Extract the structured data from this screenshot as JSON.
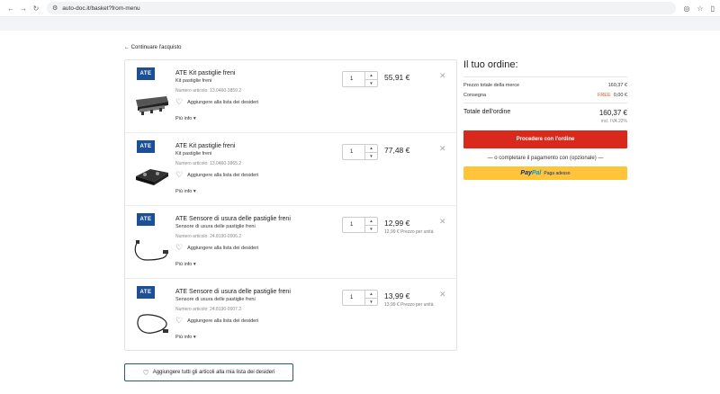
{
  "browser": {
    "url": "auto-doc.it/basket?from-menu"
  },
  "back_link": "← Continuare l'acquisto",
  "items": [
    {
      "brand": "ATE",
      "title": "ATE Kit pastiglie freni",
      "subtitle": "Kit pastiglie freni",
      "article": "Numero articolo: 13.0460-3859.2",
      "wishlist": "Aggiungere alla lista dei desideri",
      "more": "Più info ▾",
      "qty": "1",
      "price": "55,91 €",
      "unit_price": ""
    },
    {
      "brand": "ATE",
      "title": "ATE Kit pastiglie freni",
      "subtitle": "Kit pastiglie freni",
      "article": "Numero articolo: 13.0460-3865.2",
      "wishlist": "Aggiungere alla lista dei desideri",
      "more": "Più info ▾",
      "qty": "1",
      "price": "77,48 €",
      "unit_price": ""
    },
    {
      "brand": "ATE",
      "title": "ATE Sensore di usura delle pastiglie freni",
      "subtitle": "Sensore di usura delle pastiglie freni",
      "article": "Numero articolo: 24.8190-0006.2",
      "wishlist": "Aggiungere alla lista dei desideri",
      "more": "Più info ▾",
      "qty": "1",
      "price": "12,99 €",
      "unit_price": "12,99 € Prezzo per unità"
    },
    {
      "brand": "ATE",
      "title": "ATE Sensore di usura delle pastiglie freni",
      "subtitle": "Sensore di usura delle pastiglie freni",
      "article": "Numero articolo: 24.8190-0007.2",
      "wishlist": "Aggiungere alla lista dei desideri",
      "more": "Più info ▾",
      "qty": "1",
      "price": "13,99 €",
      "unit_price": "13,99 € Prezzo per unità"
    }
  ],
  "all_wishlist": "Aggiungere tutti gli articoli alla mia lista dei desideri",
  "order": {
    "title": "Il tuo ordine:",
    "goods_label": "Prezzo totale della merce",
    "goods_value": "160,37 €",
    "shipping_label": "Consegna",
    "shipping_free": "FREE",
    "shipping_value": "0,00 €",
    "total_label": "Totale dell'ordine",
    "total_value": "160,37 €",
    "vat": "incl. IVA 22%",
    "checkout_button": "Procedere con l'ordine",
    "or_text": "— o completare il pagamento con (opzionale) —",
    "paypal_brand_a": "Pay",
    "paypal_brand_b": "Pal",
    "paypal_text": "Paga adesso"
  },
  "colors": {
    "accent_red": "#d9291c",
    "free_orange": "#e8541d",
    "paypal_yellow": "#ffc439",
    "ate_blue": "#1c4f94"
  }
}
